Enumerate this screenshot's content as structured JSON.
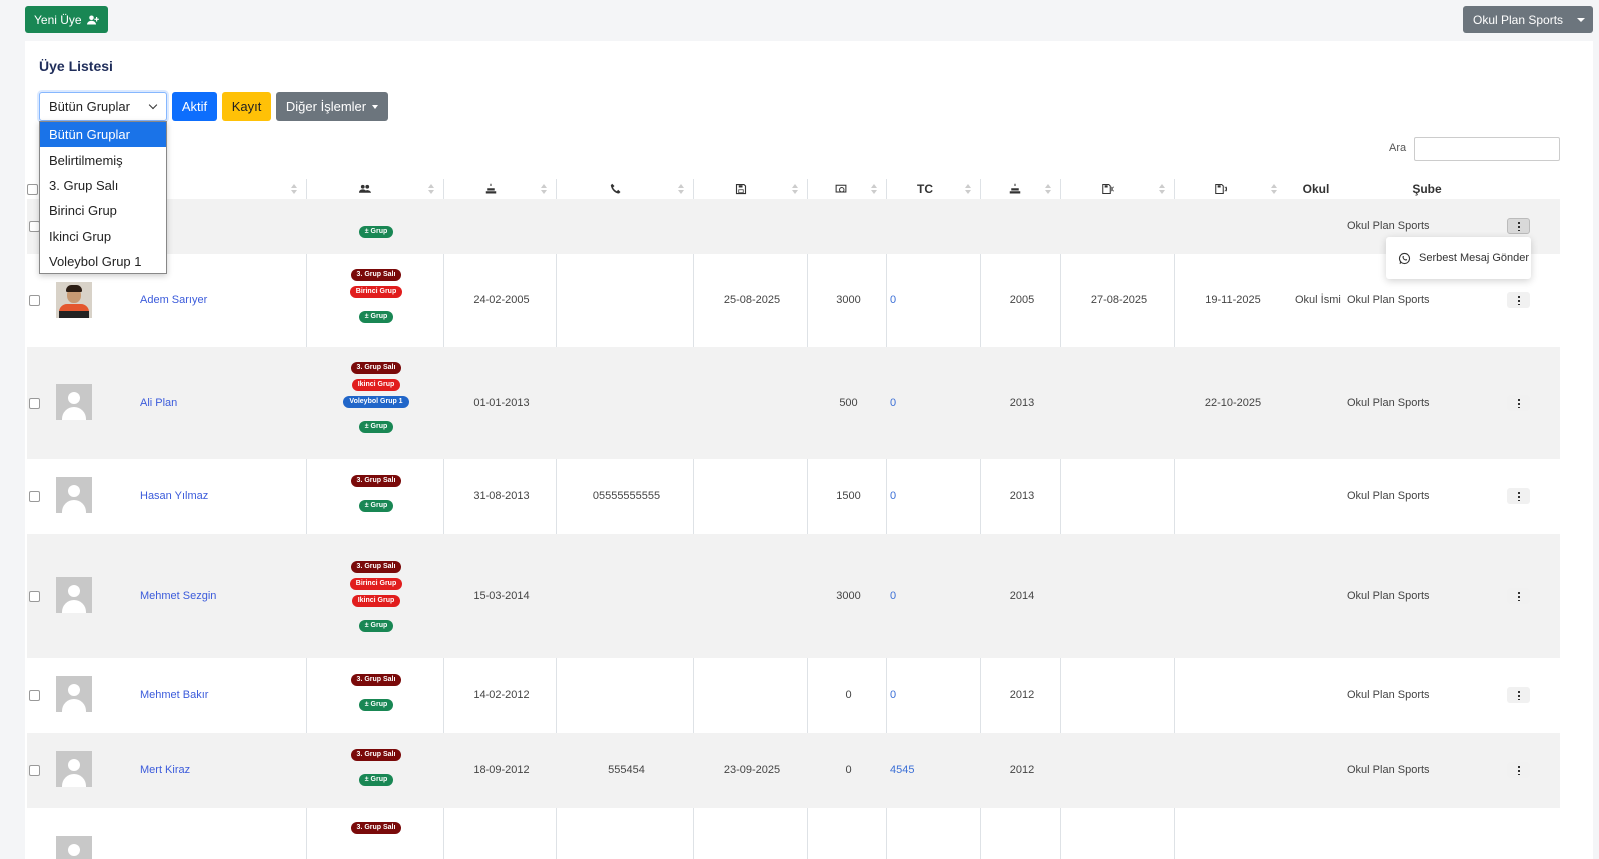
{
  "topbar": {
    "new_member_label": "Yeni Üye",
    "school_label": "Okul Plan Sports"
  },
  "card": {
    "title": "Üye Listesi"
  },
  "filters": {
    "group_select_value": "Bütün Gruplar",
    "group_options": [
      "Bütün Gruplar",
      "Belirtilmemiş",
      "3. Grup Salı",
      "Birinci Grup",
      "Ikinci Grup",
      "Voleybol Grup 1"
    ],
    "aktif_label": "Aktif",
    "kayit_label": "Kayıt",
    "diger_label": "Diğer İşlemler",
    "search_label": "Ara",
    "search_value": ""
  },
  "table": {
    "headers": {
      "tc": "TC",
      "okul": "Okul",
      "sube": "Şube"
    },
    "header_icons": [
      "users-icon",
      "cake-icon",
      "phone-icon",
      "save-icon",
      "money-icon",
      "cake-icon",
      "save-start-icon",
      "save-end-icon"
    ],
    "add_group_label": "± Grup",
    "rows": [
      {
        "name": "",
        "badges": [],
        "birth": "",
        "phone": "",
        "reg": "",
        "fee": "",
        "tc": "",
        "year": "",
        "start": "",
        "end": "",
        "okul": "",
        "sube": "Okul Plan Sports"
      },
      {
        "name": "Adem Sarıyer",
        "badges": [
          {
            "label": "3. Grup Salı",
            "kind": "salı"
          },
          {
            "label": "Birinci Grup",
            "kind": "red"
          }
        ],
        "birth": "24-02-2005",
        "phone": "",
        "reg": "25-08-2025",
        "fee": "3000",
        "tc": "0",
        "year": "2005",
        "start": "27-08-2025",
        "end": "19-11-2025",
        "okul": "Okul İsmi",
        "sube": "Okul Plan Sports"
      },
      {
        "name": "Ali Plan",
        "badges": [
          {
            "label": "3. Grup Salı",
            "kind": "salı"
          },
          {
            "label": "Ikinci Grup",
            "kind": "red"
          },
          {
            "label": "Voleybol Grup 1",
            "kind": "blue"
          }
        ],
        "birth": "01-01-2013",
        "phone": "",
        "reg": "",
        "fee": "500",
        "tc": "0",
        "year": "2013",
        "start": "",
        "end": "22-10-2025",
        "okul": "",
        "sube": "Okul Plan Sports"
      },
      {
        "name": "Hasan Yılmaz",
        "badges": [
          {
            "label": "3. Grup Salı",
            "kind": "salı"
          }
        ],
        "birth": "31-08-2013",
        "phone": "05555555555",
        "reg": "",
        "fee": "1500",
        "tc": "0",
        "year": "2013",
        "start": "",
        "end": "",
        "okul": "",
        "sube": "Okul Plan Sports"
      },
      {
        "name": "Mehmet Sezgin",
        "badges": [
          {
            "label": "3. Grup Salı",
            "kind": "salı"
          },
          {
            "label": "Birinci Grup",
            "kind": "red"
          },
          {
            "label": "Ikinci Grup",
            "kind": "red"
          }
        ],
        "birth": "15-03-2014",
        "phone": "",
        "reg": "",
        "fee": "3000",
        "tc": "0",
        "year": "2014",
        "start": "",
        "end": "",
        "okul": "",
        "sube": "Okul Plan Sports"
      },
      {
        "name": "Mehmet Bakır",
        "badges": [
          {
            "label": "3. Grup Salı",
            "kind": "salı"
          }
        ],
        "birth": "14-02-2012",
        "phone": "",
        "reg": "",
        "fee": "0",
        "tc": "0",
        "year": "2012",
        "start": "",
        "end": "",
        "okul": "",
        "sube": "Okul Plan Sports"
      },
      {
        "name": "Mert Kiraz",
        "badges": [
          {
            "label": "3. Grup Salı",
            "kind": "salı"
          }
        ],
        "birth": "18-09-2012",
        "phone": "555454",
        "reg": "23-09-2025",
        "fee": "0",
        "tc": "4545",
        "year": "2012",
        "start": "",
        "end": "",
        "okul": "",
        "sube": "Okul Plan Sports"
      },
      {
        "name": "",
        "badges": [
          {
            "label": "3. Grup Salı",
            "kind": "salı"
          }
        ],
        "birth": "",
        "phone": "",
        "reg": "",
        "fee": "",
        "tc": "",
        "year": "",
        "start": "",
        "end": "",
        "okul": "",
        "sube": ""
      }
    ]
  },
  "row_menu": {
    "send_message_label": "Serbest Mesaj Gönder"
  },
  "colors": {
    "primary": "#0d6efd",
    "success": "#198754",
    "warning": "#ffc107",
    "secondary": "#6c757d",
    "link": "#3b5bdb"
  }
}
